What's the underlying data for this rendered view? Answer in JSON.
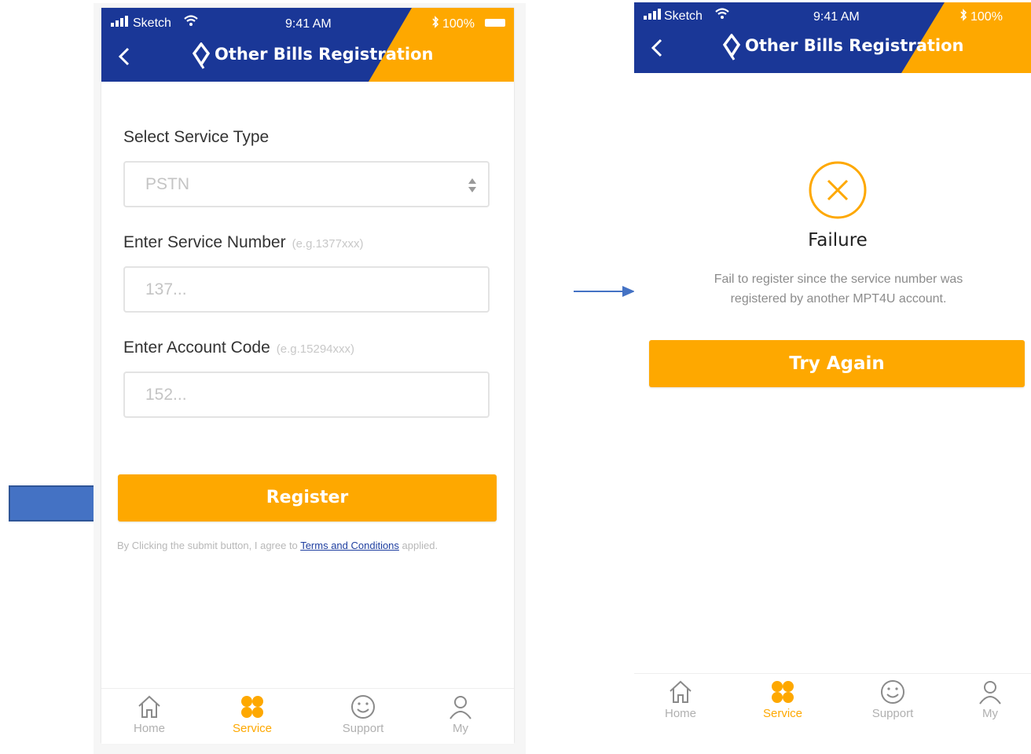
{
  "colors": {
    "brand_blue": "#1a3797",
    "accent_orange": "#fea800",
    "link_blue": "#1f3fa0",
    "arrow_blue": "#4472c4"
  },
  "status_bar": {
    "carrier": "Sketch",
    "time": "9:41 AM",
    "battery": "100%"
  },
  "header": {
    "title": "Other Bills Registration",
    "back_icon": "chevron-left-icon",
    "logo_icon": "brand-logo-icon"
  },
  "form_screen": {
    "service_type_label": "Select Service Type",
    "service_type_value": "PSTN",
    "service_number_label": "Enter Service Number",
    "service_number_hint": "(e.g.1377xxx)",
    "service_number_placeholder": "137...",
    "account_code_label": "Enter Account Code",
    "account_code_hint": "(e.g.15294xxx)",
    "account_code_placeholder": "152...",
    "register_button": "Register",
    "terms_prefix": "By Clicking the submit button,   I agree to",
    "terms_link": "Terms and Conditions",
    "terms_suffix": "applied."
  },
  "result_screen": {
    "status_icon": "close-circle-icon",
    "title": "Failure",
    "message_line1": "Fail to register since the service number was",
    "message_line2": "registered by another MPT4U account.",
    "retry_button": "Try Again"
  },
  "tabbar": {
    "items": [
      {
        "label": "Home",
        "icon": "home-icon",
        "active": false
      },
      {
        "label": "Service",
        "icon": "service-grid-icon",
        "active": true
      },
      {
        "label": "Support",
        "icon": "smiley-icon",
        "active": false
      },
      {
        "label": "My",
        "icon": "person-icon",
        "active": false
      }
    ]
  },
  "annotations": {
    "big_arrow": "arrow-right-icon",
    "flow_arrow": "arrow-right-icon"
  }
}
